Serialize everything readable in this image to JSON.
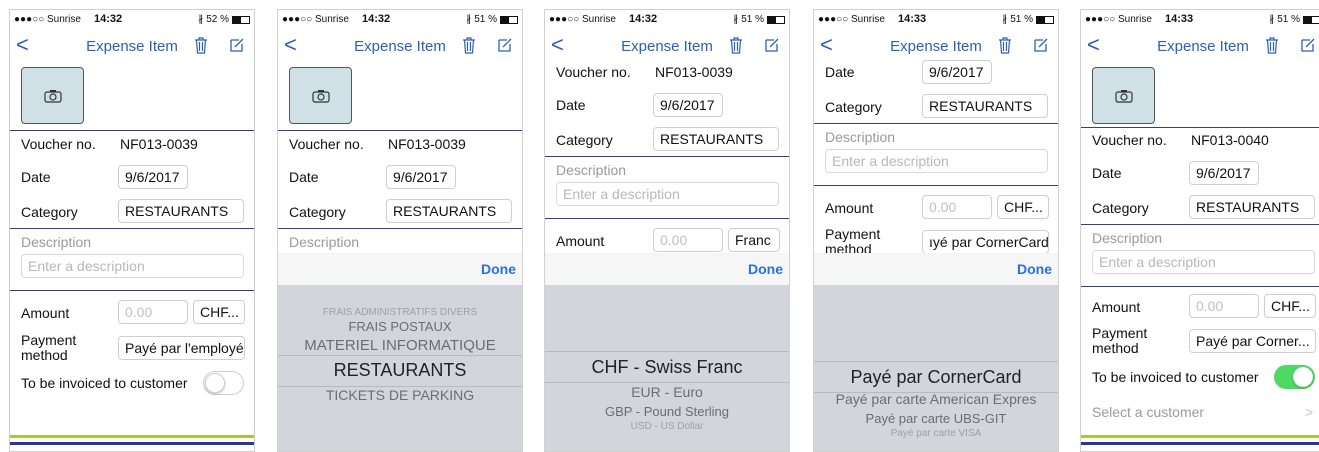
{
  "status": {
    "carrier": "●●●○○ Sunrise",
    "times": [
      "14:32",
      "14:32",
      "14:32",
      "14:33",
      "14:33"
    ],
    "batteries": [
      "52 %",
      "51 %",
      "51 %",
      "51 %",
      "51 %"
    ]
  },
  "nav": {
    "title": "Expense Item",
    "back": "<"
  },
  "labels": {
    "voucher": "Voucher no.",
    "date": "Date",
    "category": "Category",
    "description": "Description",
    "amount": "Amount",
    "payment": "Payment\nmethod",
    "invoice": "To be invoiced to customer",
    "customer": "Select a customer",
    "done": "Done"
  },
  "values": {
    "voucher1": "NF013-0039",
    "voucher5": "NF013-0040",
    "date": "9/6/2017",
    "category": "RESTAURANTS",
    "description_placeholder": "Enter a description",
    "amount_placeholder": "0.00",
    "currency_short": "CHF...",
    "currency_franc": "Franc",
    "payment1": "Payé par l'employé",
    "payment4": "ıyé par CornerCard",
    "payment5": "Payé par Corner...",
    "chevron": ">"
  },
  "pickers": {
    "category": [
      "FRAIS ADMINISTRATIFS DIVERS",
      "FRAIS POSTAUX",
      "MATERIEL INFORMATIQUE",
      "RESTAURANTS",
      "TICKETS DE PARKING"
    ],
    "currency": [
      "CHF - Swiss Franc",
      "EUR - Euro",
      "GBP - Pound Sterling",
      "USD - US Dollar"
    ],
    "payment": [
      "Payé par CornerCard",
      "Payé par carte American Expres",
      "Payé par carte UBS-GIT",
      "Payé par carte VISA"
    ]
  },
  "colors": {
    "accent": "#2b5fb8",
    "done": "#2b6fe0",
    "toggle_on": "#4cd964",
    "bar_green": "#a9c63e",
    "bar_blue": "#283a8f"
  },
  "icons": [
    "camera-icon",
    "trash-icon",
    "edit-icon",
    "back-chevron-icon",
    "chevron-right-icon",
    "wifi-icon",
    "bluetooth-icon",
    "battery-icon"
  ]
}
